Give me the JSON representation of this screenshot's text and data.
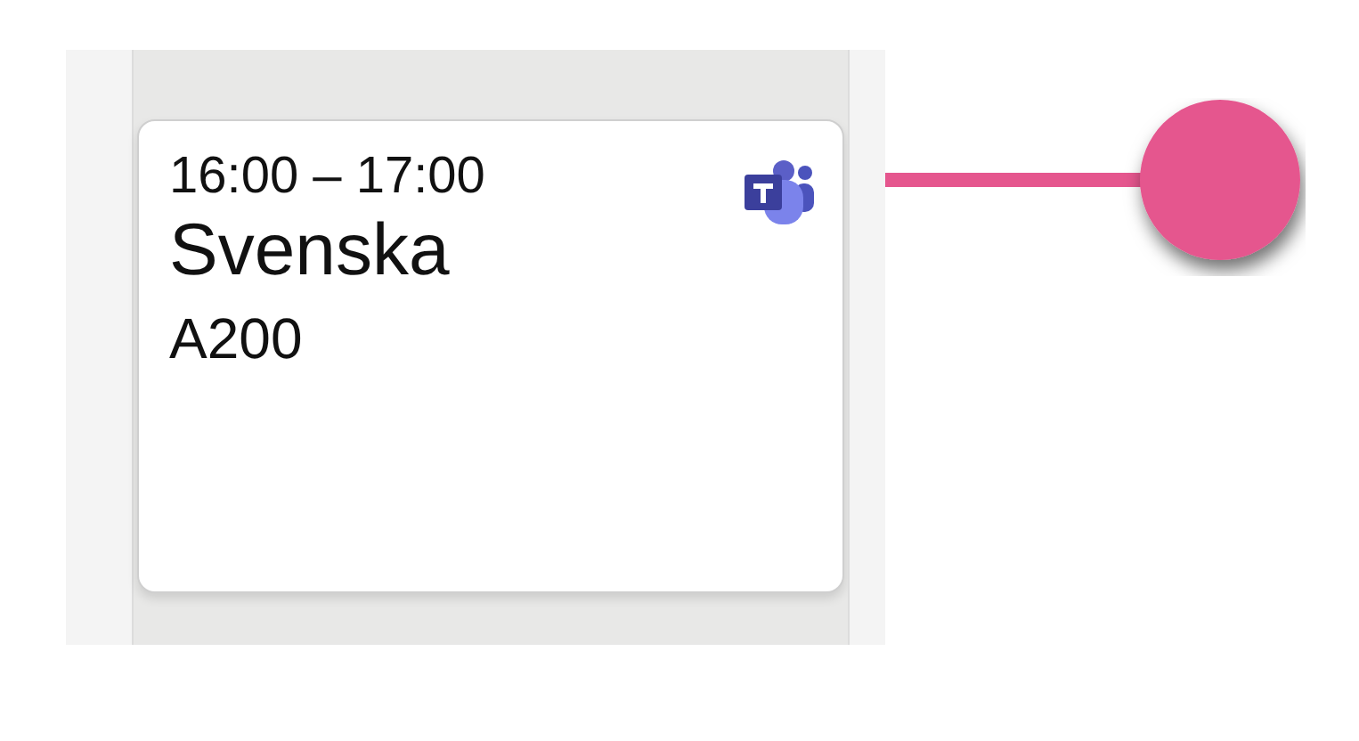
{
  "event": {
    "time": "16:00 – 17:00",
    "title": "Svenska",
    "room": "A200"
  }
}
